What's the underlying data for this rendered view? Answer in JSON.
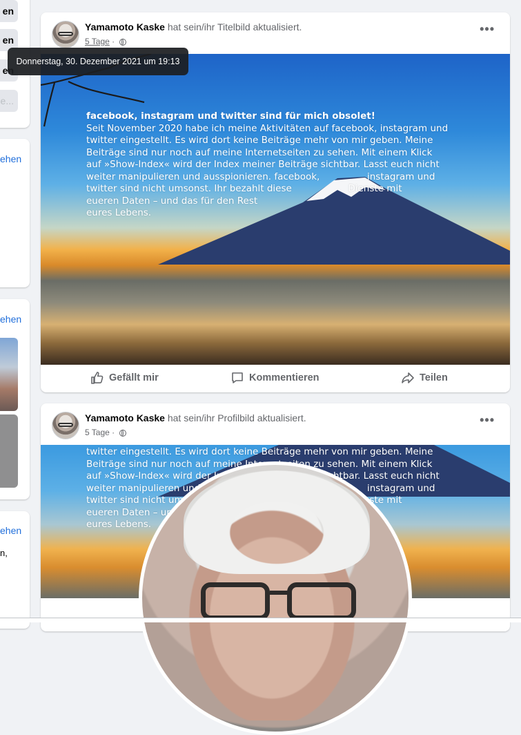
{
  "left_column": {
    "btn1": "en",
    "btn2": "en",
    "btn3": "en",
    "btn4": "ge...",
    "link1": "ehen",
    "link2": "ehen",
    "link3": "ehen",
    "text_tail": "n,"
  },
  "tooltip": "Donnerstag, 30. Dezember 2021 um 19:13",
  "post1": {
    "author": "Yamamoto Kaske",
    "action": "hat sein/ihr Titelbild aktualisiert.",
    "age": "5 Tage",
    "separator": "·",
    "more_icon": "more-horizontal-icon",
    "image_text": {
      "headline": "facebook, instagram und twitter sind für mich obsolet!",
      "lines": [
        "Seit November 2020 habe ich meine Aktivitäten auf facebook, instagram und",
        "twitter eingestellt. Es wird dort keine Beiträge mehr von mir geben. Meine",
        "Beiträge sind nur noch auf meine Internetseiten zu sehen. Mit einem Klick",
        "auf »Show-Index« wird der Index meiner Beiträge sichtbar. Lasst euch nicht",
        "weiter manipulieren und ausspionieren. facebook,                instagram und",
        "twitter sind nicht umsonst. Ihr bezahlt diese                   Dienste mit",
        "eueren Daten – und das für den Rest",
        "eures Lebens."
      ]
    },
    "actions": {
      "like": "Gefällt mir",
      "comment": "Kommentieren",
      "share": "Teilen"
    }
  },
  "post2": {
    "author": "Yamamoto Kaske",
    "action": "hat sein/ihr Profilbild aktualisiert.",
    "age": "5 Tage",
    "separator": "·",
    "more_icon": "more-horizontal-icon",
    "image_text": {
      "lines": [
        "twitter eingestellt. Es wird dort keine Beiträge mehr von mir geben. Meine",
        "Beiträge sind nur noch auf meine Internetseiten zu sehen. Mit einem Klick",
        "auf »Show-Index« wird der Index meiner Beiträge sichtbar. Lasst euch nicht",
        "weiter manipulieren und ausspionieren. facebook,                instagram und",
        "twitter sind nicht umsonst. Ihr bezahlt diese                   Dienste mit",
        "eueren Daten – und das für den Rest",
        "eures Lebens."
      ]
    }
  }
}
